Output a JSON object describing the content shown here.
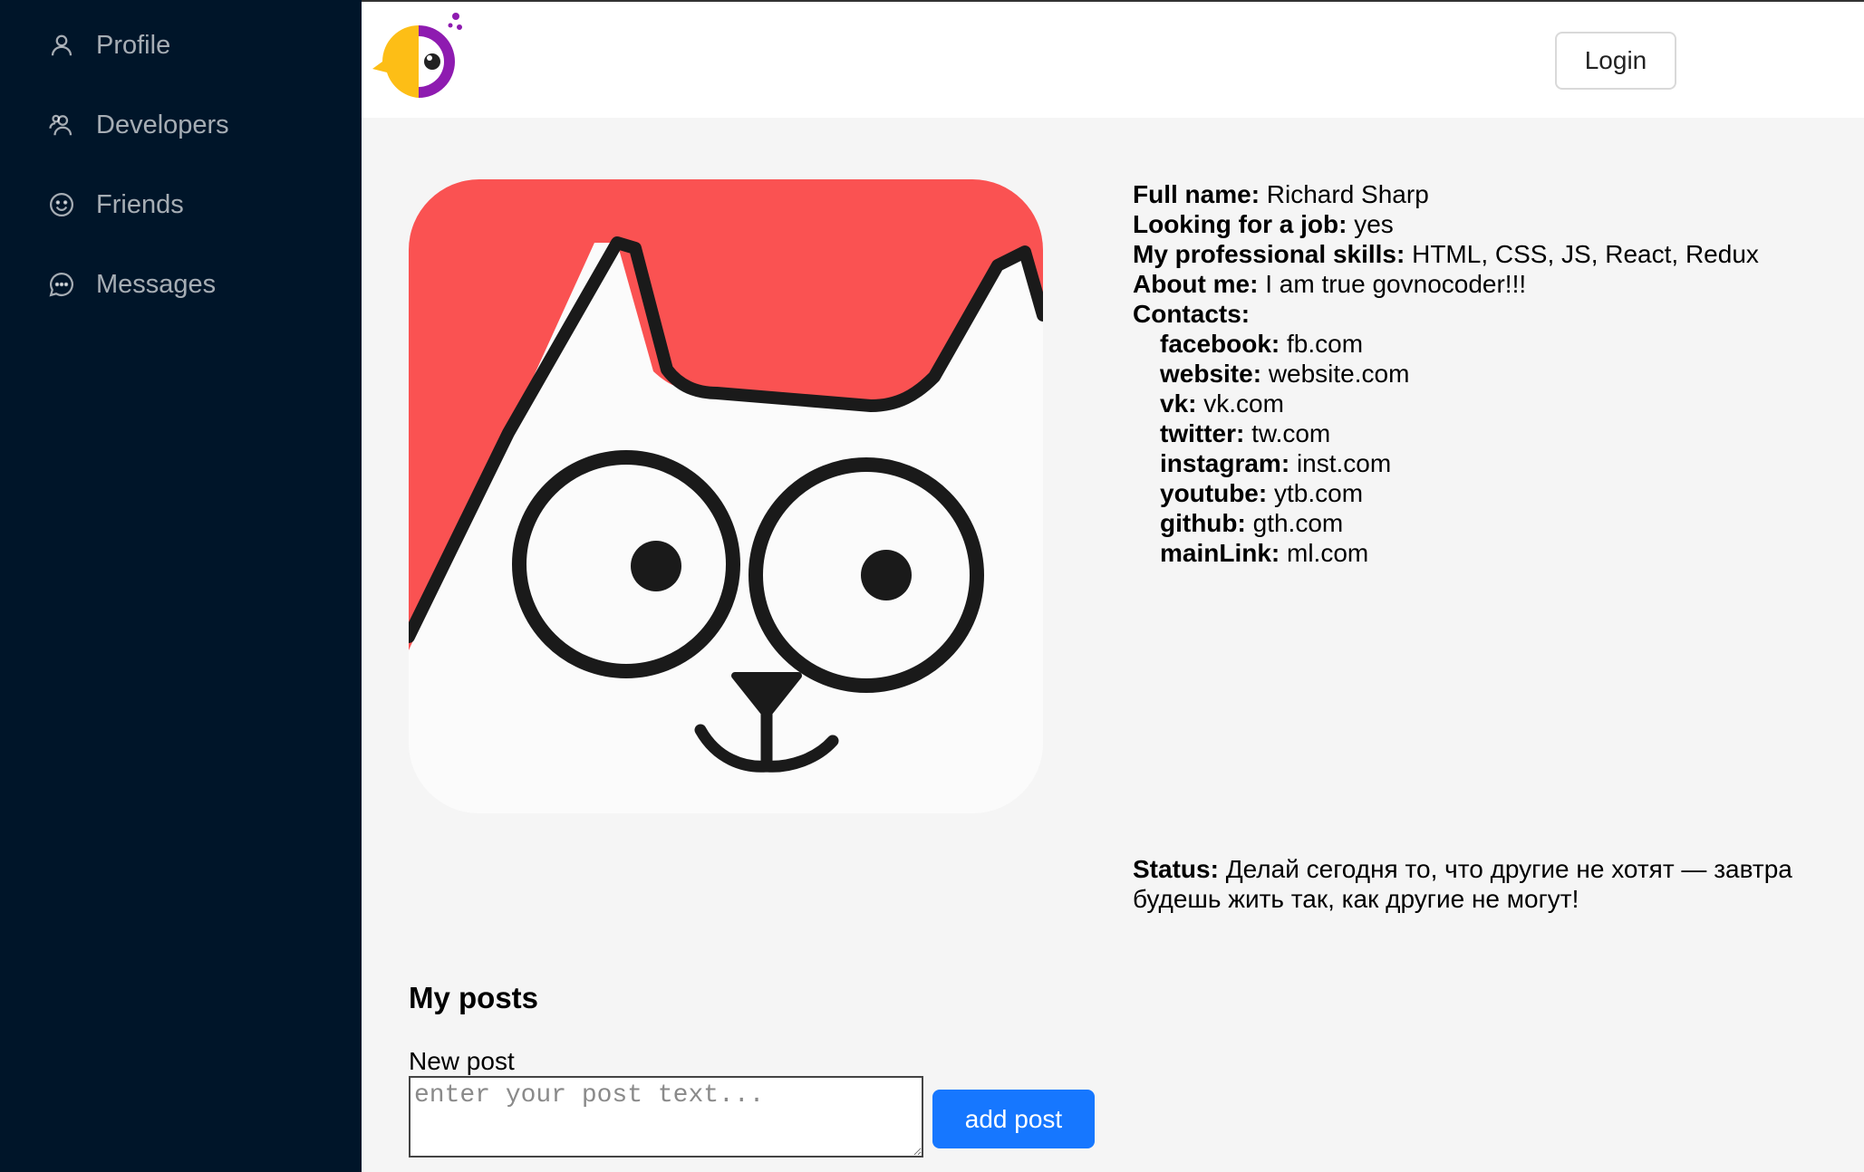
{
  "sidebar": {
    "items": [
      {
        "label": "Profile",
        "icon": "user-icon"
      },
      {
        "label": "Developers",
        "icon": "team-icon"
      },
      {
        "label": "Friends",
        "icon": "smile-icon"
      },
      {
        "label": "Messages",
        "icon": "message-icon"
      }
    ]
  },
  "header": {
    "logo": "parrot-logo-icon",
    "login_label": "Login"
  },
  "profile": {
    "avatar": "cat-avatar",
    "full_name_label": "Full name:",
    "full_name": "Richard Sharp",
    "looking_label": "Looking for a job:",
    "looking": "yes",
    "skills_label": "My professional skills:",
    "skills": "HTML, CSS, JS, React, Redux",
    "about_label": "About me:",
    "about": "I am true govnocoder!!!",
    "contacts_label": "Contacts:",
    "contacts": [
      {
        "key": "facebook:",
        "value": "fb.com"
      },
      {
        "key": "website:",
        "value": "website.com"
      },
      {
        "key": "vk:",
        "value": "vk.com"
      },
      {
        "key": "twitter:",
        "value": "tw.com"
      },
      {
        "key": "instagram:",
        "value": "inst.com"
      },
      {
        "key": "youtube:",
        "value": "ytb.com"
      },
      {
        "key": "github:",
        "value": "gth.com"
      },
      {
        "key": "mainLink:",
        "value": "ml.com"
      }
    ],
    "status_label": "Status:",
    "status": "Делай сегодня то, что другие не хотят — завтра будешь жить так, как другие не могут!"
  },
  "posts": {
    "title": "My posts",
    "new_post_label": "New post",
    "placeholder": "enter your post text...",
    "add_label": "add post"
  },
  "colors": {
    "sidebar_bg": "#001529",
    "primary": "#1677ff",
    "avatar_red": "#fa5252"
  }
}
